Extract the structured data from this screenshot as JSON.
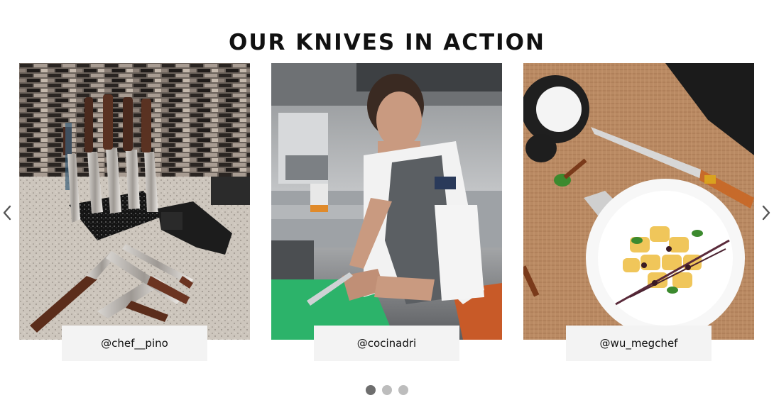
{
  "section": {
    "title": "OUR KNIVES IN ACTION"
  },
  "carousel": {
    "prev_icon": "chevron-left-icon",
    "next_icon": "chevron-right-icon",
    "slides": [
      {
        "handle": "@chef__pino",
        "photo": "knife-set-magnetic-block-photo"
      },
      {
        "handle": "@cocinadri",
        "photo": "chef-cutting-board-photo"
      },
      {
        "handle": "@wu_megchef",
        "photo": "plated-dish-with-knife-photo"
      }
    ],
    "pagination": {
      "total": 3,
      "active_index": 0
    }
  },
  "colors": {
    "dot_active": "#6e6e6e",
    "dot_inactive": "#bdbdbd",
    "handle_bg": "#f3f3f3"
  }
}
